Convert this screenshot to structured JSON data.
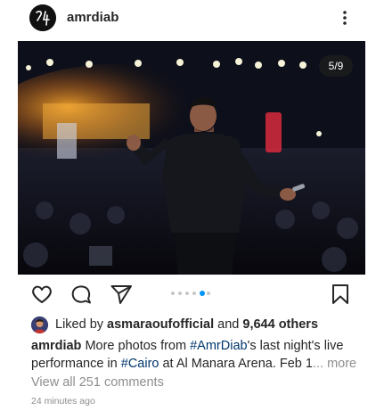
{
  "post": {
    "username": "amrdiab",
    "slide_counter": "5/9",
    "carousel": {
      "total": 6,
      "active_index": 4
    },
    "liked_by": {
      "prefix": "Liked by ",
      "user": "asmaraoufofficial",
      "and": " and ",
      "others": "9,644 others"
    },
    "caption": {
      "username": "amrdiab",
      "text_1": " More photos from ",
      "tag_1": "#AmrDiab",
      "text_2": "'s last night's live performance in ",
      "tag_2": "#Cairo",
      "text_3": " at Al Manara Arena. Feb 1",
      "more": "... more"
    },
    "comments_link": "View all 251 comments",
    "timestamp": "24 minutes ago"
  },
  "icons": {
    "more": "more-vertical-icon",
    "like": "heart-outline-icon",
    "comment": "comment-bubble-icon",
    "share": "paper-plane-icon",
    "save": "bookmark-outline-icon"
  },
  "colors": {
    "text": "#262626",
    "secondary": "#8e8e8e",
    "hashtag": "#00376b",
    "active_dot": "#0095f6",
    "inactive_dot": "#c7c7c7"
  }
}
